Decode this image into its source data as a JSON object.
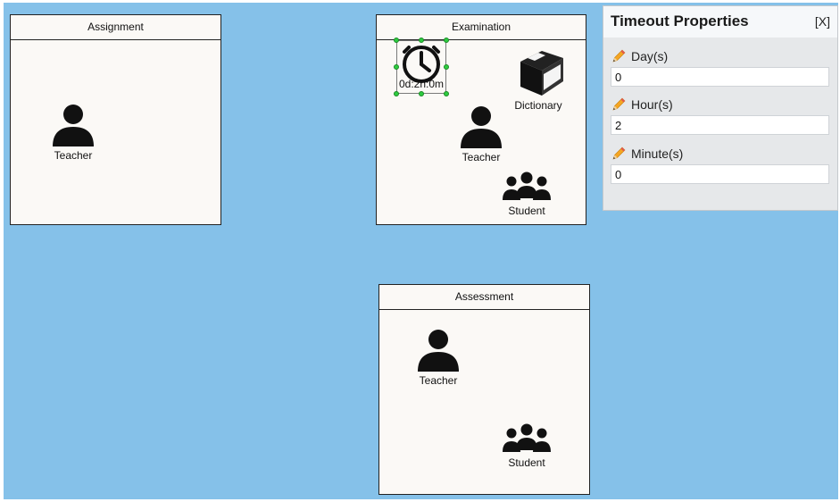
{
  "colors": {
    "canvas_background": "#85c1e9",
    "box_background": "#fbf9f6",
    "handle_color": "#2ecc40"
  },
  "boxes": {
    "assignment": {
      "title": "Assignment",
      "teacher_label": "Teacher"
    },
    "examination": {
      "title": "Examination",
      "timer_label": "0d:2h:0m",
      "dictionary_label": "Dictionary",
      "teacher_label": "Teacher",
      "student_label": "Student"
    },
    "assessment": {
      "title": "Assessment",
      "teacher_label": "Teacher",
      "student_label": "Student"
    }
  },
  "properties_panel": {
    "title": "Timeout Properties",
    "close_label": "[X]",
    "fields": [
      {
        "label": "Day(s)",
        "value": "0"
      },
      {
        "label": "Hour(s)",
        "value": "2"
      },
      {
        "label": "Minute(s)",
        "value": "0"
      }
    ]
  },
  "icons": [
    "person-icon",
    "group-icon",
    "clock-icon",
    "book-icon",
    "pencil-icon"
  ]
}
